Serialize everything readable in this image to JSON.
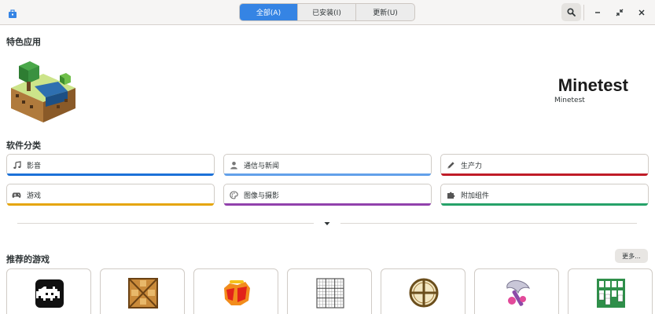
{
  "header": {
    "tabs": [
      {
        "label": "全部(A)",
        "active": true
      },
      {
        "label": "已安装(I)",
        "active": false
      },
      {
        "label": "更新(U)",
        "active": false
      }
    ],
    "icons": {
      "app": "software-store-icon",
      "search": "search-icon",
      "minimize": "minimize-icon",
      "restore": "restore-icon",
      "close": "close-icon"
    }
  },
  "featured": {
    "section_title": "特色应用",
    "app_name": "Minetest",
    "app_subtitle": "Minetest"
  },
  "categories": {
    "section_title": "软件分类",
    "items": [
      {
        "label": "影音",
        "icon": "music-note-icon",
        "color": "#1c71d8"
      },
      {
        "label": "通信与新闻",
        "icon": "person-icon",
        "color": "#62a0ea"
      },
      {
        "label": "生产力",
        "icon": "pencil-icon",
        "color": "#c01c28"
      },
      {
        "label": "游戏",
        "icon": "gamepad-icon",
        "color": "#e5a50a"
      },
      {
        "label": "图像与摄影",
        "icon": "palette-icon",
        "color": "#9141ac"
      },
      {
        "label": "附加组件",
        "icon": "puzzle-icon",
        "color": "#26a269"
      }
    ]
  },
  "games": {
    "section_title": "推荐的游戏",
    "more_label": "更多...",
    "items": [
      {
        "icon": "space-invader-icon"
      },
      {
        "icon": "dosbox-icon"
      },
      {
        "icon": "supertuxkart-icon"
      },
      {
        "icon": "sudoku-icon"
      },
      {
        "icon": "crosshair-icon"
      },
      {
        "icon": "axe-icon"
      },
      {
        "icon": "solitaire-icon"
      }
    ]
  }
}
